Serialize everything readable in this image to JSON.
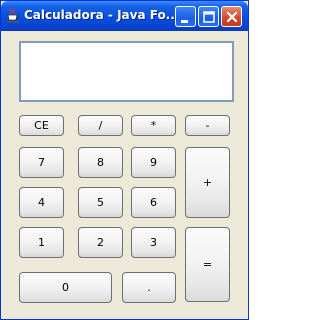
{
  "window": {
    "title": "Calculadora - Java Fo..."
  },
  "display": {
    "value": ""
  },
  "buttons": {
    "ce": "CE",
    "divide": "/",
    "multiply": "*",
    "subtract": "-",
    "seven": "7",
    "eight": "8",
    "nine": "9",
    "add": "+",
    "four": "4",
    "five": "5",
    "six": "6",
    "one": "1",
    "two": "2",
    "three": "3",
    "equals": "=",
    "zero": "0",
    "decimal": "."
  },
  "icons": {
    "app": "java-cup-icon",
    "minimize": "minimize-icon",
    "maximize": "maximize-icon",
    "close": "close-icon"
  },
  "colors": {
    "titlebar": "#0a4fdc",
    "window_bg": "#ece9d8",
    "close_button": "#d4462a"
  }
}
